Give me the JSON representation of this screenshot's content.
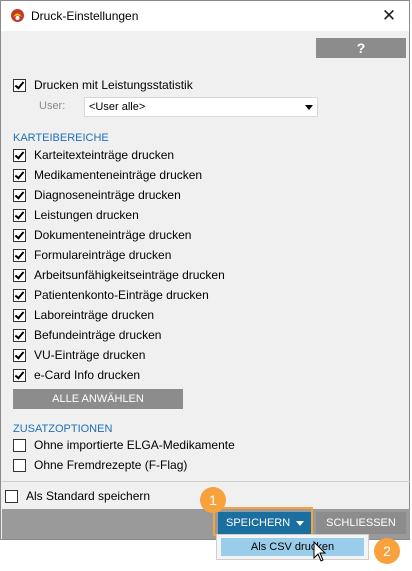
{
  "window": {
    "title": "Druck-Einstellungen",
    "close_glyph": "✕",
    "help_label": "?"
  },
  "print_stats": {
    "label": "Drucken mit Leistungsstatistik",
    "checked": true
  },
  "user_field": {
    "label": "User:",
    "value": "<User alle>"
  },
  "karteibereiche": {
    "heading": "KARTEIBEREICHE",
    "items": [
      {
        "label": "Karteitexteinträge drucken",
        "checked": true
      },
      {
        "label": "Medikamenteneinträge drucken",
        "checked": true
      },
      {
        "label": "Diagnoseneinträge drucken",
        "checked": true
      },
      {
        "label": "Leistungen drucken",
        "checked": true
      },
      {
        "label": "Dokumenteneinträge drucken",
        "checked": true
      },
      {
        "label": "Formulareinträge drucken",
        "checked": true
      },
      {
        "label": "Arbeitsunfähigkeitseinträge drucken",
        "checked": true
      },
      {
        "label": "Patientenkonto-Einträge drucken",
        "checked": true
      },
      {
        "label": "Laboreinträge drucken",
        "checked": true
      },
      {
        "label": "Befundeinträge drucken",
        "checked": true
      },
      {
        "label": "VU-Einträge drucken",
        "checked": true
      },
      {
        "label": "e-Card Info drucken",
        "checked": true
      }
    ],
    "select_all_label": "ALLE ANWÄHLEN"
  },
  "zusatzoptionen": {
    "heading": "ZUSATZOPTIONEN",
    "items": [
      {
        "label": "Ohne importierte ELGA-Medikamente",
        "checked": false
      },
      {
        "label": "Ohne Fremdrezepte (F-Flag)",
        "checked": false
      }
    ]
  },
  "save_default": {
    "label": "Als Standard speichern",
    "checked": false
  },
  "footer": {
    "save_label": "SPEICHERN",
    "close_label": "SCHLIESSEN"
  },
  "save_menu": {
    "items": [
      "Als CSV drucken"
    ]
  },
  "callouts": {
    "step1": "1",
    "step2": "2"
  },
  "colors": {
    "accent_blue": "#1a6ea0",
    "section_blue": "#1f6fb8",
    "callout_orange": "#f7a23c",
    "menu_highlight": "#99cdea"
  },
  "icons": [
    "app-icon",
    "close-icon",
    "help-icon",
    "checkbox-icon",
    "chevron-down-icon",
    "mouse-cursor-icon"
  ]
}
